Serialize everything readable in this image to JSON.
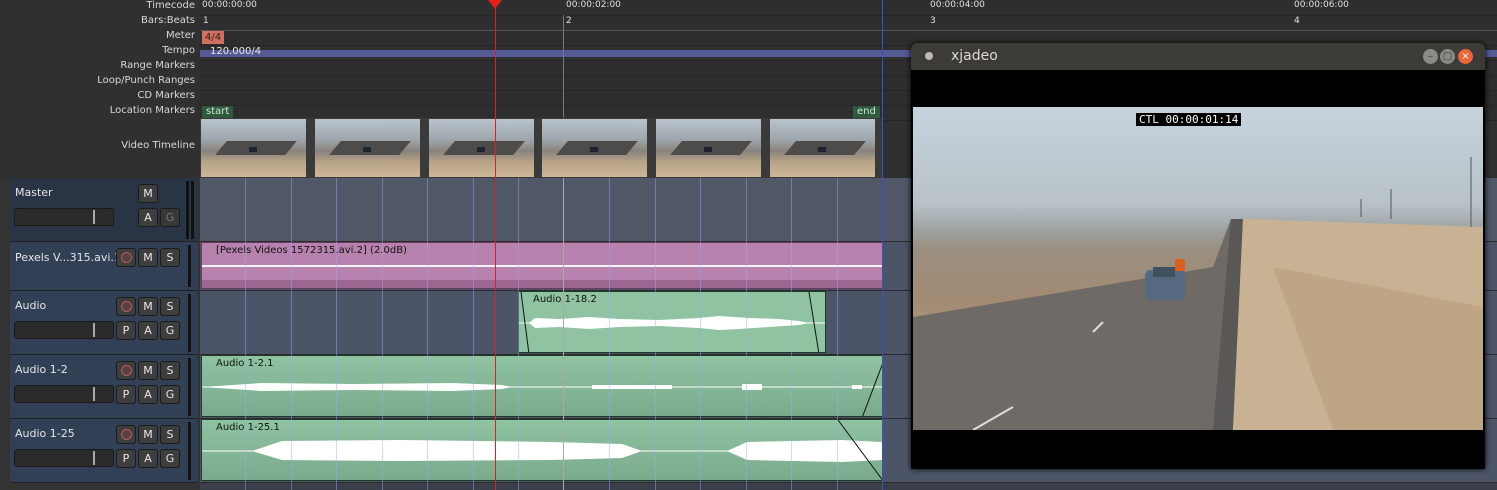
{
  "ruler": {
    "labels": [
      "Timecode",
      "Bars:Beats",
      "Meter",
      "Tempo",
      "Range Markers",
      "Loop/Punch Ranges",
      "CD Markers",
      "Location Markers"
    ],
    "timecodes": [
      "00:00:00:00",
      "00:00:02:00",
      "00:00:04:00",
      "00:00:06:00"
    ],
    "bars": [
      "1",
      "2",
      "3",
      "4"
    ],
    "meter": "4/4",
    "tempo": "120.000/4",
    "markers": {
      "start": "start",
      "end": "end"
    },
    "video_timeline_label": "Video Timeline"
  },
  "tracks": [
    {
      "name": "Master",
      "buttons": [
        "M",
        "A",
        "G"
      ]
    },
    {
      "name": "Pexels V...315.avi.1",
      "buttons": [
        "M",
        "S"
      ]
    },
    {
      "name": "Audio",
      "buttons": [
        "M",
        "S",
        "P",
        "A",
        "G"
      ]
    },
    {
      "name": "Audio 1-2",
      "buttons": [
        "M",
        "S",
        "P",
        "A",
        "G"
      ]
    },
    {
      "name": "Audio 1-25",
      "buttons": [
        "M",
        "S",
        "P",
        "A",
        "G"
      ]
    }
  ],
  "regions": {
    "pexels": "[Pexels Videos 1572315.avi.2] (2.0dB)",
    "audio": "Audio 1-18.2",
    "audio12": "Audio 1-2.1",
    "audio125": "Audio 1-25.1"
  },
  "xjadeo": {
    "title": "xjadeo",
    "timecode": "CTL 00:00:01:14"
  },
  "colors": {
    "playhead": "#e0201c",
    "region_midi": "#b77fab",
    "region_audio": "#8fc3a2",
    "track_head": "#324056"
  }
}
